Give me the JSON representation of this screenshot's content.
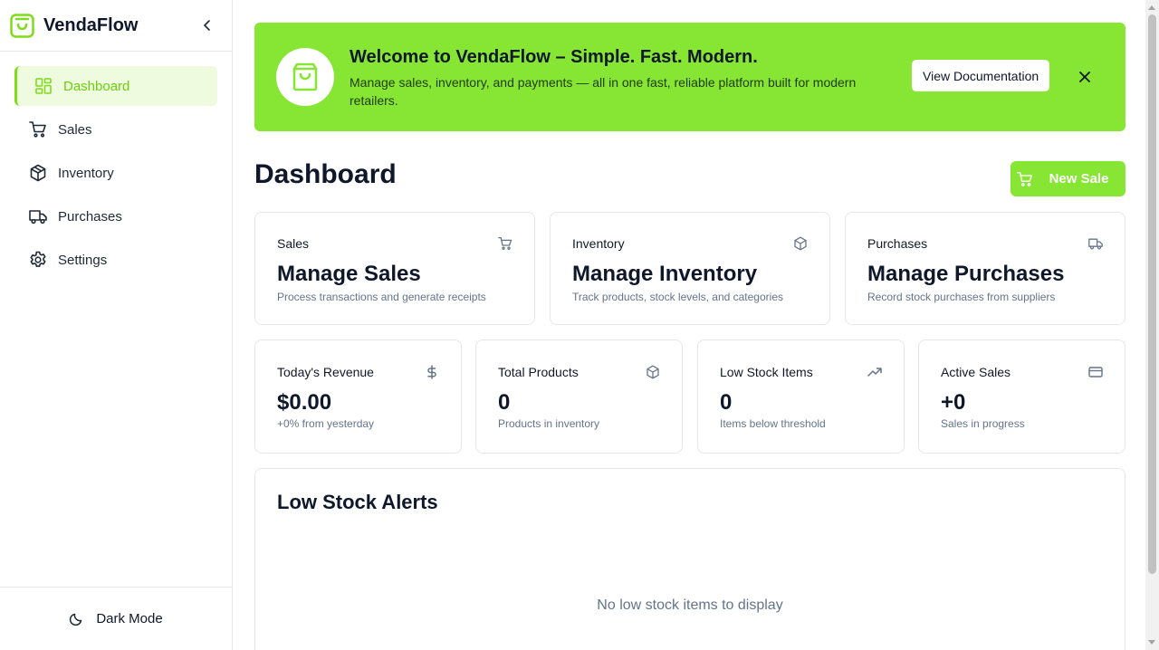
{
  "app": {
    "name": "VendaFlow",
    "accent_color": "#86e633",
    "active_nav_color": "#6ccf0c"
  },
  "sidebar": {
    "collapse_icon": "chevron-left-icon",
    "items": [
      {
        "label": "Dashboard",
        "icon": "layout-grid-icon",
        "active": true
      },
      {
        "label": "Sales",
        "icon": "cart-icon",
        "active": false
      },
      {
        "label": "Inventory",
        "icon": "box-icon",
        "active": false
      },
      {
        "label": "Purchases",
        "icon": "truck-icon",
        "active": false
      },
      {
        "label": "Settings",
        "icon": "gear-icon",
        "active": false
      }
    ],
    "dark_mode_label": "Dark Mode"
  },
  "banner": {
    "title": "Welcome to VendaFlow – Simple. Fast. Modern.",
    "description": "Manage sales, inventory, and payments — all in one fast, reliable platform built for modern retailers.",
    "doc_button": "View Documentation",
    "close_icon": "close-icon"
  },
  "page": {
    "title": "Dashboard",
    "new_sale_button": "New Sale"
  },
  "nav_cards": [
    {
      "label": "Sales",
      "title": "Manage Sales",
      "subtitle": "Process transactions and generate receipts",
      "icon": "cart-icon"
    },
    {
      "label": "Inventory",
      "title": "Manage Inventory",
      "subtitle": "Track products, stock levels, and categories",
      "icon": "box-icon"
    },
    {
      "label": "Purchases",
      "title": "Manage Purchases",
      "subtitle": "Record stock purchases from suppliers",
      "icon": "truck-icon"
    }
  ],
  "stats": [
    {
      "label": "Today's Revenue",
      "value": "$0.00",
      "subtitle": "+0% from yesterday",
      "icon": "dollar-icon"
    },
    {
      "label": "Total Products",
      "value": "0",
      "subtitle": "Products in inventory",
      "icon": "box-icon"
    },
    {
      "label": "Low Stock Items",
      "value": "0",
      "subtitle": "Items below threshold",
      "icon": "trending-up-icon"
    },
    {
      "label": "Active Sales",
      "value": "+0",
      "subtitle": "Sales in progress",
      "icon": "credit-card-icon"
    }
  ],
  "alerts": {
    "title": "Low Stock Alerts",
    "empty_message": "No low stock items to display"
  }
}
